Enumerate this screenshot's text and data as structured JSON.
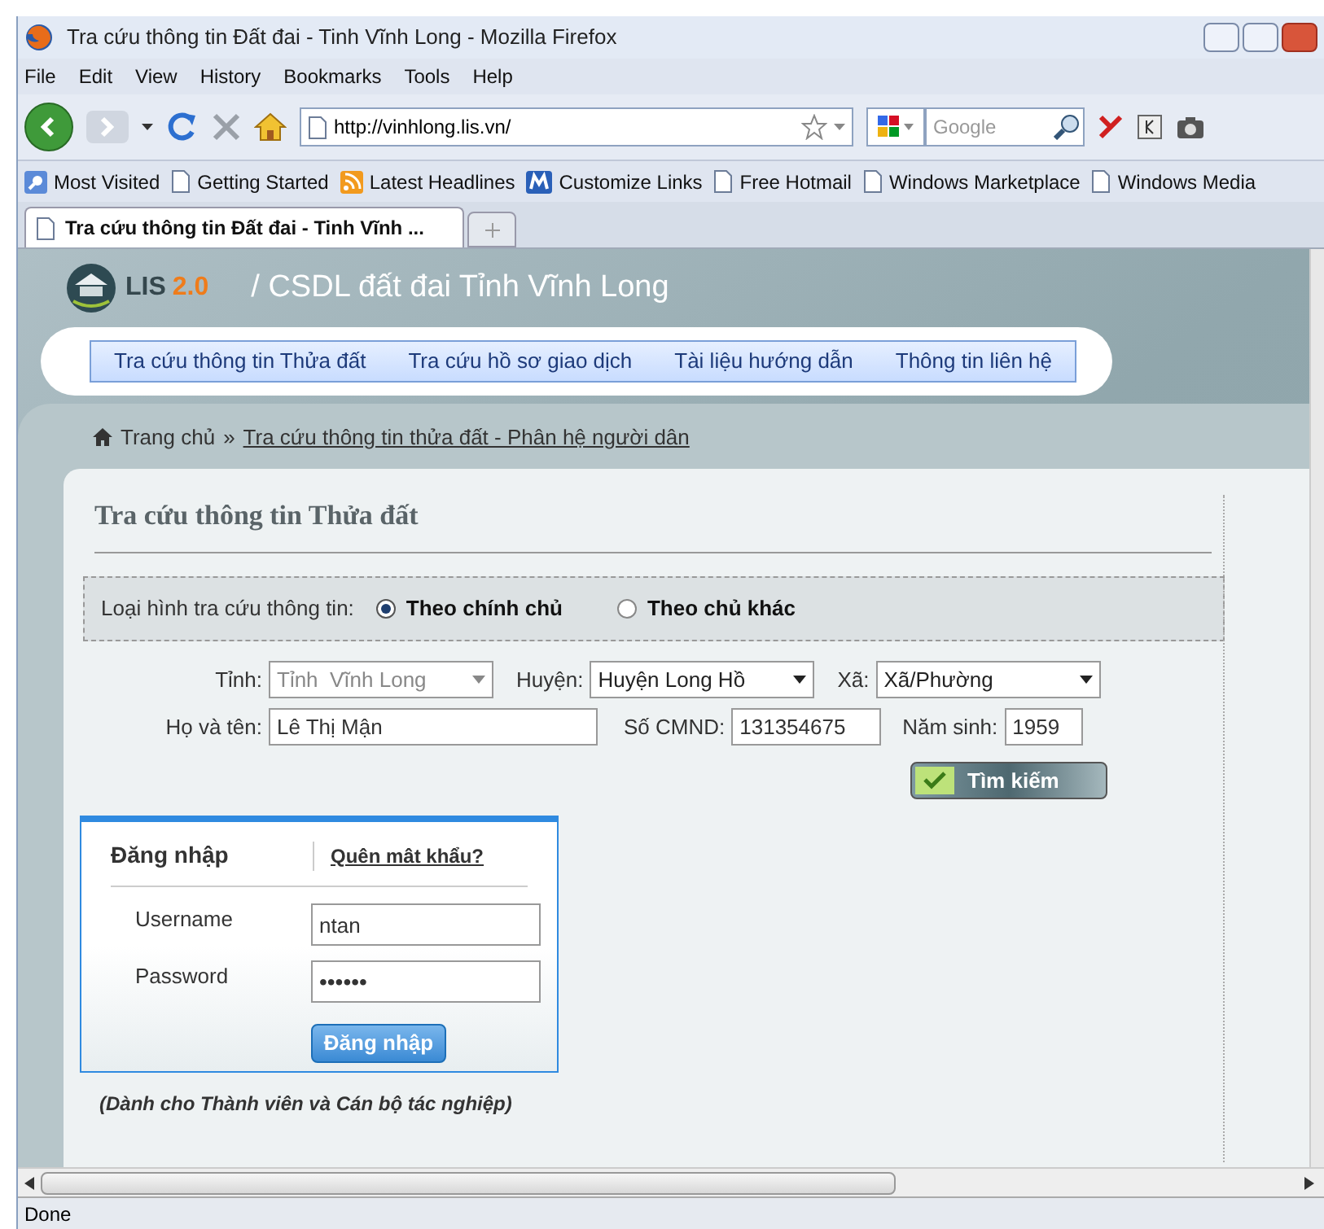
{
  "window": {
    "title": "Tra cứu thông tin Đất đai - Tinh Vĩnh Long - Mozilla Firefox"
  },
  "menu": [
    "File",
    "Edit",
    "View",
    "History",
    "Bookmarks",
    "Tools",
    "Help"
  ],
  "toolbar": {
    "url": "http://vinhlong.lis.vn/",
    "search_placeholder": "Google"
  },
  "bookmarks": [
    "Most Visited",
    "Getting Started",
    "Latest Headlines",
    "Customize Links",
    "Free Hotmail",
    "Windows Marketplace",
    "Windows Media"
  ],
  "tabs": [
    {
      "label": "Tra cứu thông tin Đất đai - Tinh Vĩnh ...",
      "selected": true
    }
  ],
  "page": {
    "logo": "LIS",
    "logo_version": "2.0",
    "site_title": "/ CSDL đất đai Tỉnh Vĩnh Long",
    "nav": [
      "Tra cứu thông tin Thửa đất",
      "Tra cứu hồ sơ giao dịch",
      "Tài liệu hướng dẫn",
      "Thông tin liên hệ"
    ],
    "breadcrumb": {
      "home": "Trang chủ",
      "separator": "»",
      "current": "Tra cứu thông tin thửa đất - Phân hệ người dân"
    },
    "search": {
      "title": "Tra cứu thông tin Thửa đất",
      "type_label": "Loại hình tra cứu thông tin:",
      "types": [
        {
          "label": "Theo chính chủ",
          "selected": true
        },
        {
          "label": "Theo chủ khác",
          "selected": false
        }
      ],
      "selects": [
        {
          "label": "Tỉnh:",
          "value": "Tỉnh  Vĩnh Long",
          "disabled": true
        },
        {
          "label": "Huyện:",
          "value": "Huyện Long Hồ",
          "disabled": false
        },
        {
          "label": "Xã:",
          "value": "Xã/Phường",
          "disabled": false
        }
      ],
      "name": {
        "label": "Họ và tên:",
        "value": "Lê Thị Mận"
      },
      "id_number": {
        "label": "Số CMND:",
        "value": "131354675"
      },
      "birth_year": {
        "label": "Năm sinh:",
        "value": "1959"
      },
      "button": "Tìm kiếm"
    },
    "login": {
      "title": "Đăng nhập",
      "forgot": "Quên mât khẩu?",
      "username": {
        "label": "Username",
        "value": "ntan"
      },
      "password": {
        "label": "Password",
        "value": "••••••"
      },
      "button": "Đăng nhập",
      "note": "(Dành cho Thành viên và Cán bộ tác nghiệp)"
    }
  },
  "status_bar": "Done"
}
